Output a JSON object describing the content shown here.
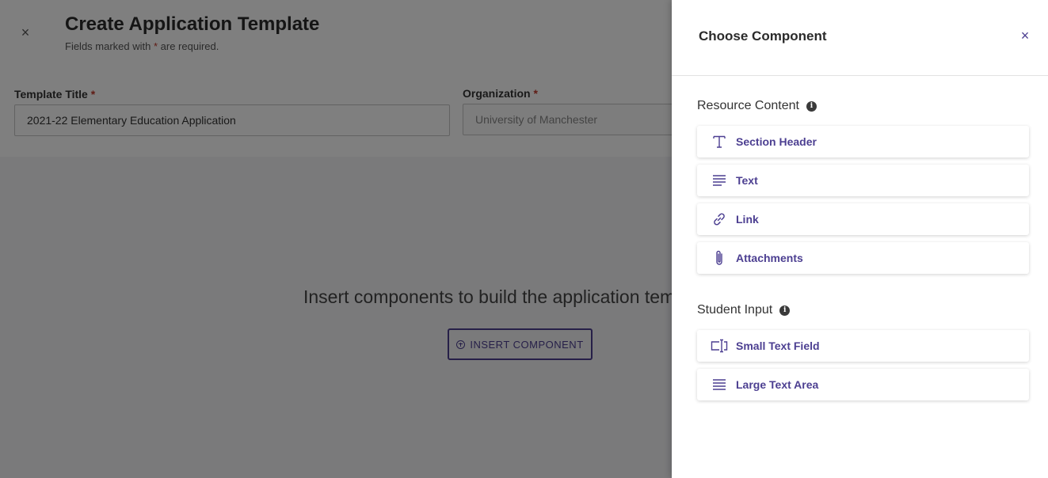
{
  "background": {
    "title": "Create Application Template",
    "subtitle_prefix": "Fields marked with ",
    "required_mark": "*",
    "subtitle_suffix": " are required.",
    "close_glyph": "×",
    "fields": [
      {
        "label": "Template Title",
        "value": "2021-22 Elementary Education Application"
      },
      {
        "label": "Organization",
        "value": "University of Manchester"
      }
    ],
    "empty_message": "Insert components to build the application template.",
    "insert_button_label": "INSERT COMPONENT"
  },
  "drawer": {
    "title": "Choose Component",
    "close_glyph": "×",
    "sections": [
      {
        "title": "Resource Content",
        "info_glyph": "i",
        "items": [
          {
            "label": "Section Header",
            "icon": "text-t-icon"
          },
          {
            "label": "Text",
            "icon": "lines-icon"
          },
          {
            "label": "Link",
            "icon": "link-icon"
          },
          {
            "label": "Attachments",
            "icon": "paperclip-icon"
          }
        ]
      },
      {
        "title": "Student Input",
        "info_glyph": "i",
        "items": [
          {
            "label": "Small Text Field",
            "icon": "text-field-icon"
          },
          {
            "label": "Large Text Area",
            "icon": "lines-icon"
          }
        ]
      }
    ]
  },
  "colors": {
    "accent": "#4c3f91",
    "required": "#c0392b",
    "scrim": "rgba(0,0,0,0.5)"
  }
}
